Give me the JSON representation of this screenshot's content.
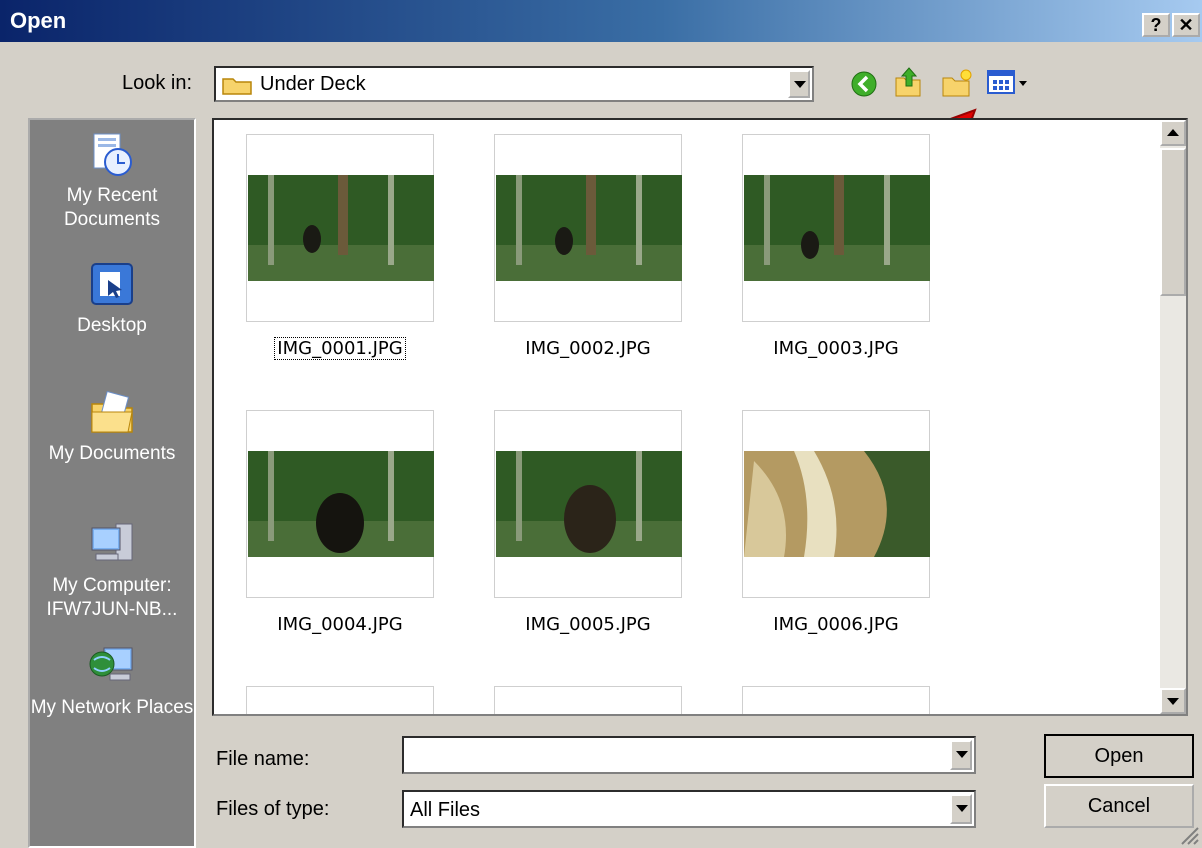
{
  "window": {
    "title": "Open",
    "help_label": "?",
    "close_label": "✕"
  },
  "toolbar": {
    "look_in_label": "Look in:",
    "look_in_value": "Under Deck",
    "icons": [
      "back-icon",
      "up-folder-icon",
      "new-folder-icon",
      "views-menu-icon"
    ]
  },
  "places": [
    {
      "label": "My Recent Documents",
      "icon": "recent-documents-icon"
    },
    {
      "label": "Desktop",
      "icon": "desktop-icon"
    },
    {
      "label": "My Documents",
      "icon": "my-documents-icon"
    },
    {
      "label": "My Computer: IFW7JUN-NB...",
      "icon": "my-computer-icon"
    },
    {
      "label": "My Network Places",
      "icon": "network-places-icon"
    }
  ],
  "files": [
    {
      "name": "IMG_0001.JPG"
    },
    {
      "name": "IMG_0002.JPG"
    },
    {
      "name": "IMG_0003.JPG"
    },
    {
      "name": "IMG_0004.JPG"
    },
    {
      "name": "IMG_0005.JPG"
    },
    {
      "name": "IMG_0006.JPG"
    }
  ],
  "form": {
    "file_name_label": "File name:",
    "file_name_value": "",
    "files_of_type_label": "Files of type:",
    "files_of_type_value": "All Files"
  },
  "buttons": {
    "open": "Open",
    "cancel": "Cancel"
  },
  "colors": {
    "title_gradient_start": "#0a246a",
    "title_gradient_end": "#a6caf0",
    "annotation_arrow": "#e00000",
    "places_bar": "#808080"
  }
}
